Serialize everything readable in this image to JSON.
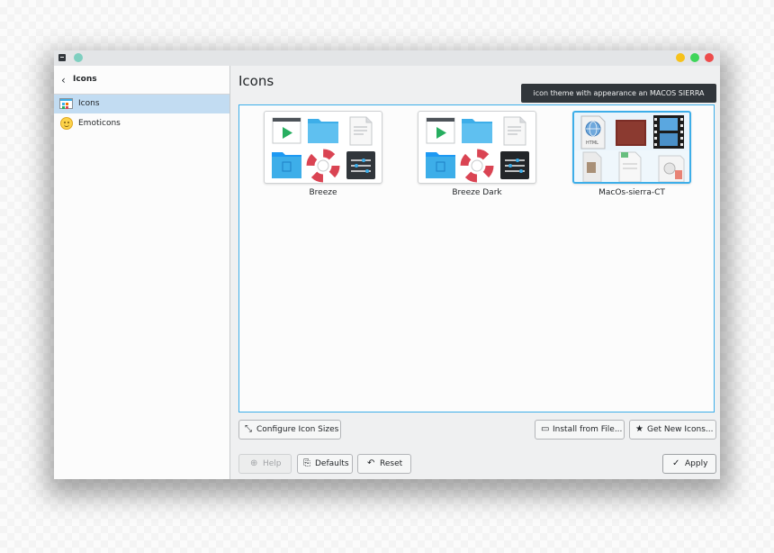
{
  "sidebar": {
    "title": "Icons",
    "items": [
      {
        "label": "Icons",
        "icon": "icons-grid-icon",
        "selected": true
      },
      {
        "label": "Emoticons",
        "icon": "smiley-icon",
        "selected": false
      }
    ]
  },
  "main": {
    "title": "Icons",
    "tooltip": "icon theme with appearance an MACOS SIERRA",
    "themes": [
      {
        "name": "Breeze",
        "selected": false
      },
      {
        "name": "Breeze Dark",
        "selected": false
      },
      {
        "name": "MacOs-sierra-CT",
        "selected": true
      }
    ],
    "preview_html_label": "HTML"
  },
  "buttons": {
    "configure_sizes": "Configure Icon Sizes",
    "install_from_file": "Install from File...",
    "get_new_icons": "Get New Icons...",
    "help": "Help",
    "defaults": "Defaults",
    "reset": "Reset",
    "apply": "Apply"
  },
  "window_controls": {
    "minimize": "#f6c21b",
    "maximize": "#3ed55a",
    "close": "#ed4c4c"
  },
  "colors": {
    "accent": "#3daee9",
    "selection": "#c2dcf2"
  }
}
